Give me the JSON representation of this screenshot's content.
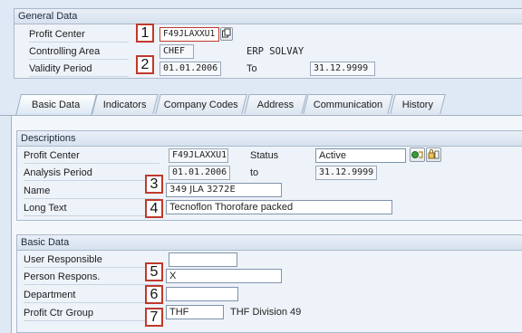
{
  "general": {
    "title": "General Data",
    "profit_center_label": "Profit Center",
    "profit_center_value": "F49JLAXXU1",
    "controlling_area_label": "Controlling Area",
    "controlling_area_value": "CHEF",
    "controlling_area_name": "ERP SOLVAY",
    "validity_label": "Validity Period",
    "validity_from": "01.01.2006",
    "to_label": "To",
    "validity_to": "31.12.9999"
  },
  "tabs": [
    "Basic Data",
    "Indicators",
    "Company Codes",
    "Address",
    "Communication",
    "History"
  ],
  "descriptions": {
    "title": "Descriptions",
    "profit_center_label": "Profit Center",
    "profit_center_value": "F49JLAXXU1",
    "status_label": "Status",
    "status_value": "Active",
    "analysis_label": "Analysis Period",
    "analysis_from": "01.01.2006",
    "to_label": "to",
    "analysis_to": "31.12.9999",
    "name_label": "Name",
    "name_value": "349 JLA 3272E",
    "long_text_label": "Long Text",
    "long_text_value": "Tecnoflon Thorofare packed"
  },
  "basic": {
    "title": "Basic Data",
    "user_resp_label": "User Responsible",
    "user_resp_value": "",
    "person_resp_label": "Person Respons.",
    "person_resp_value": "X",
    "department_label": "Department",
    "department_value": "",
    "group_label": "Profit Ctr Group",
    "group_value": "THF",
    "group_desc": "THF Division 49"
  },
  "markers": [
    "1",
    "2",
    "3",
    "4",
    "5",
    "6",
    "7"
  ],
  "colors": {
    "marker_border": "#c0392b",
    "status_icon": "#3a9c3a"
  },
  "icons": [
    "copy-icon",
    "status-activate-icon",
    "status-lock-icon"
  ]
}
